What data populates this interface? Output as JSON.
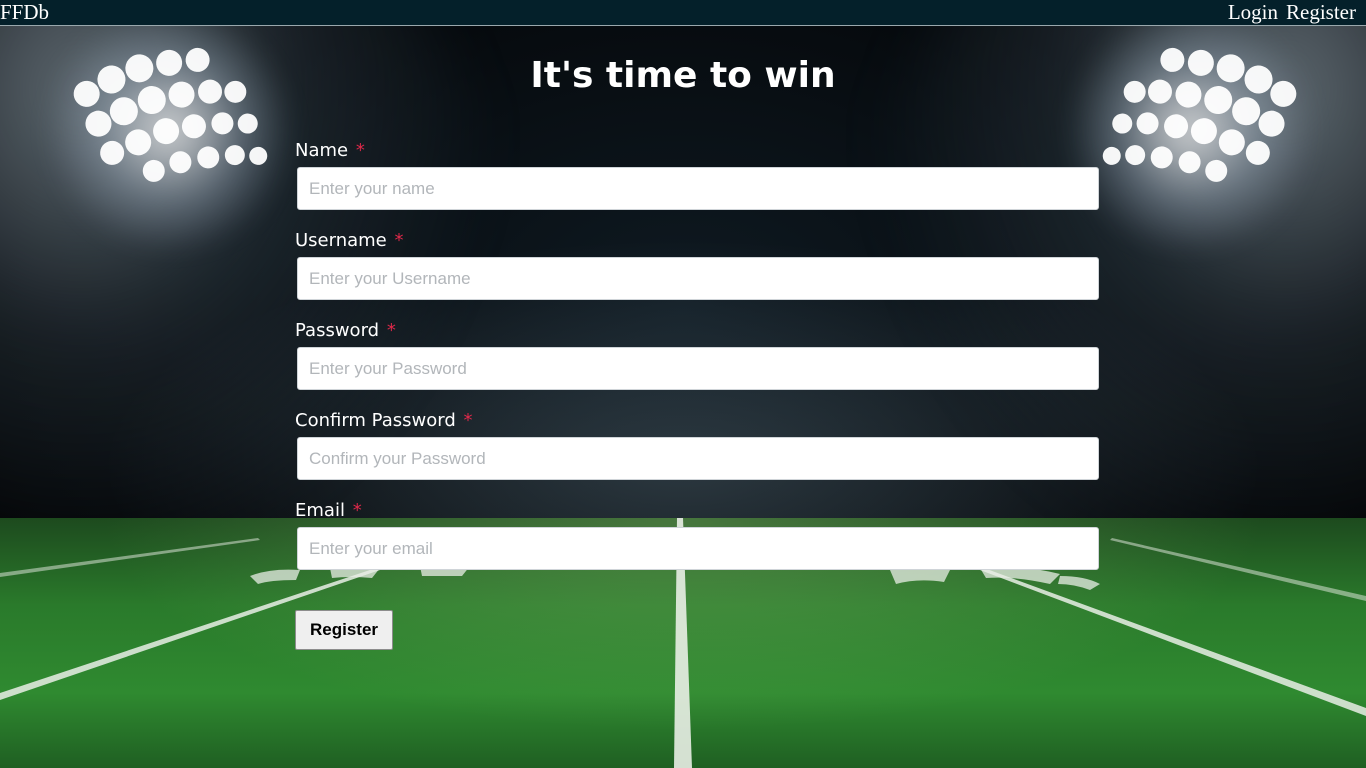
{
  "nav": {
    "brand": "FFDb",
    "links": [
      {
        "label": "Login"
      },
      {
        "label": "Register"
      }
    ]
  },
  "page": {
    "title": "It's time to win"
  },
  "form": {
    "required_marker": "*",
    "fields": [
      {
        "label": "Name",
        "placeholder": "Enter your name",
        "value": ""
      },
      {
        "label": "Username",
        "placeholder": "Enter your Username",
        "value": ""
      },
      {
        "label": "Password",
        "placeholder": "Enter your Password",
        "value": ""
      },
      {
        "label": "Confirm Password",
        "placeholder": "Confirm your Password",
        "value": ""
      },
      {
        "label": "Email",
        "placeholder": "Enter your email",
        "value": ""
      }
    ],
    "submit_label": "Register"
  },
  "colors": {
    "navbar_bg": "#04202a",
    "required_star": "#e0284a",
    "title_text": "#ffffff",
    "field_green": "#2f8a30"
  },
  "background": {
    "scene": "night football stadium with floodlights and yard lines"
  }
}
